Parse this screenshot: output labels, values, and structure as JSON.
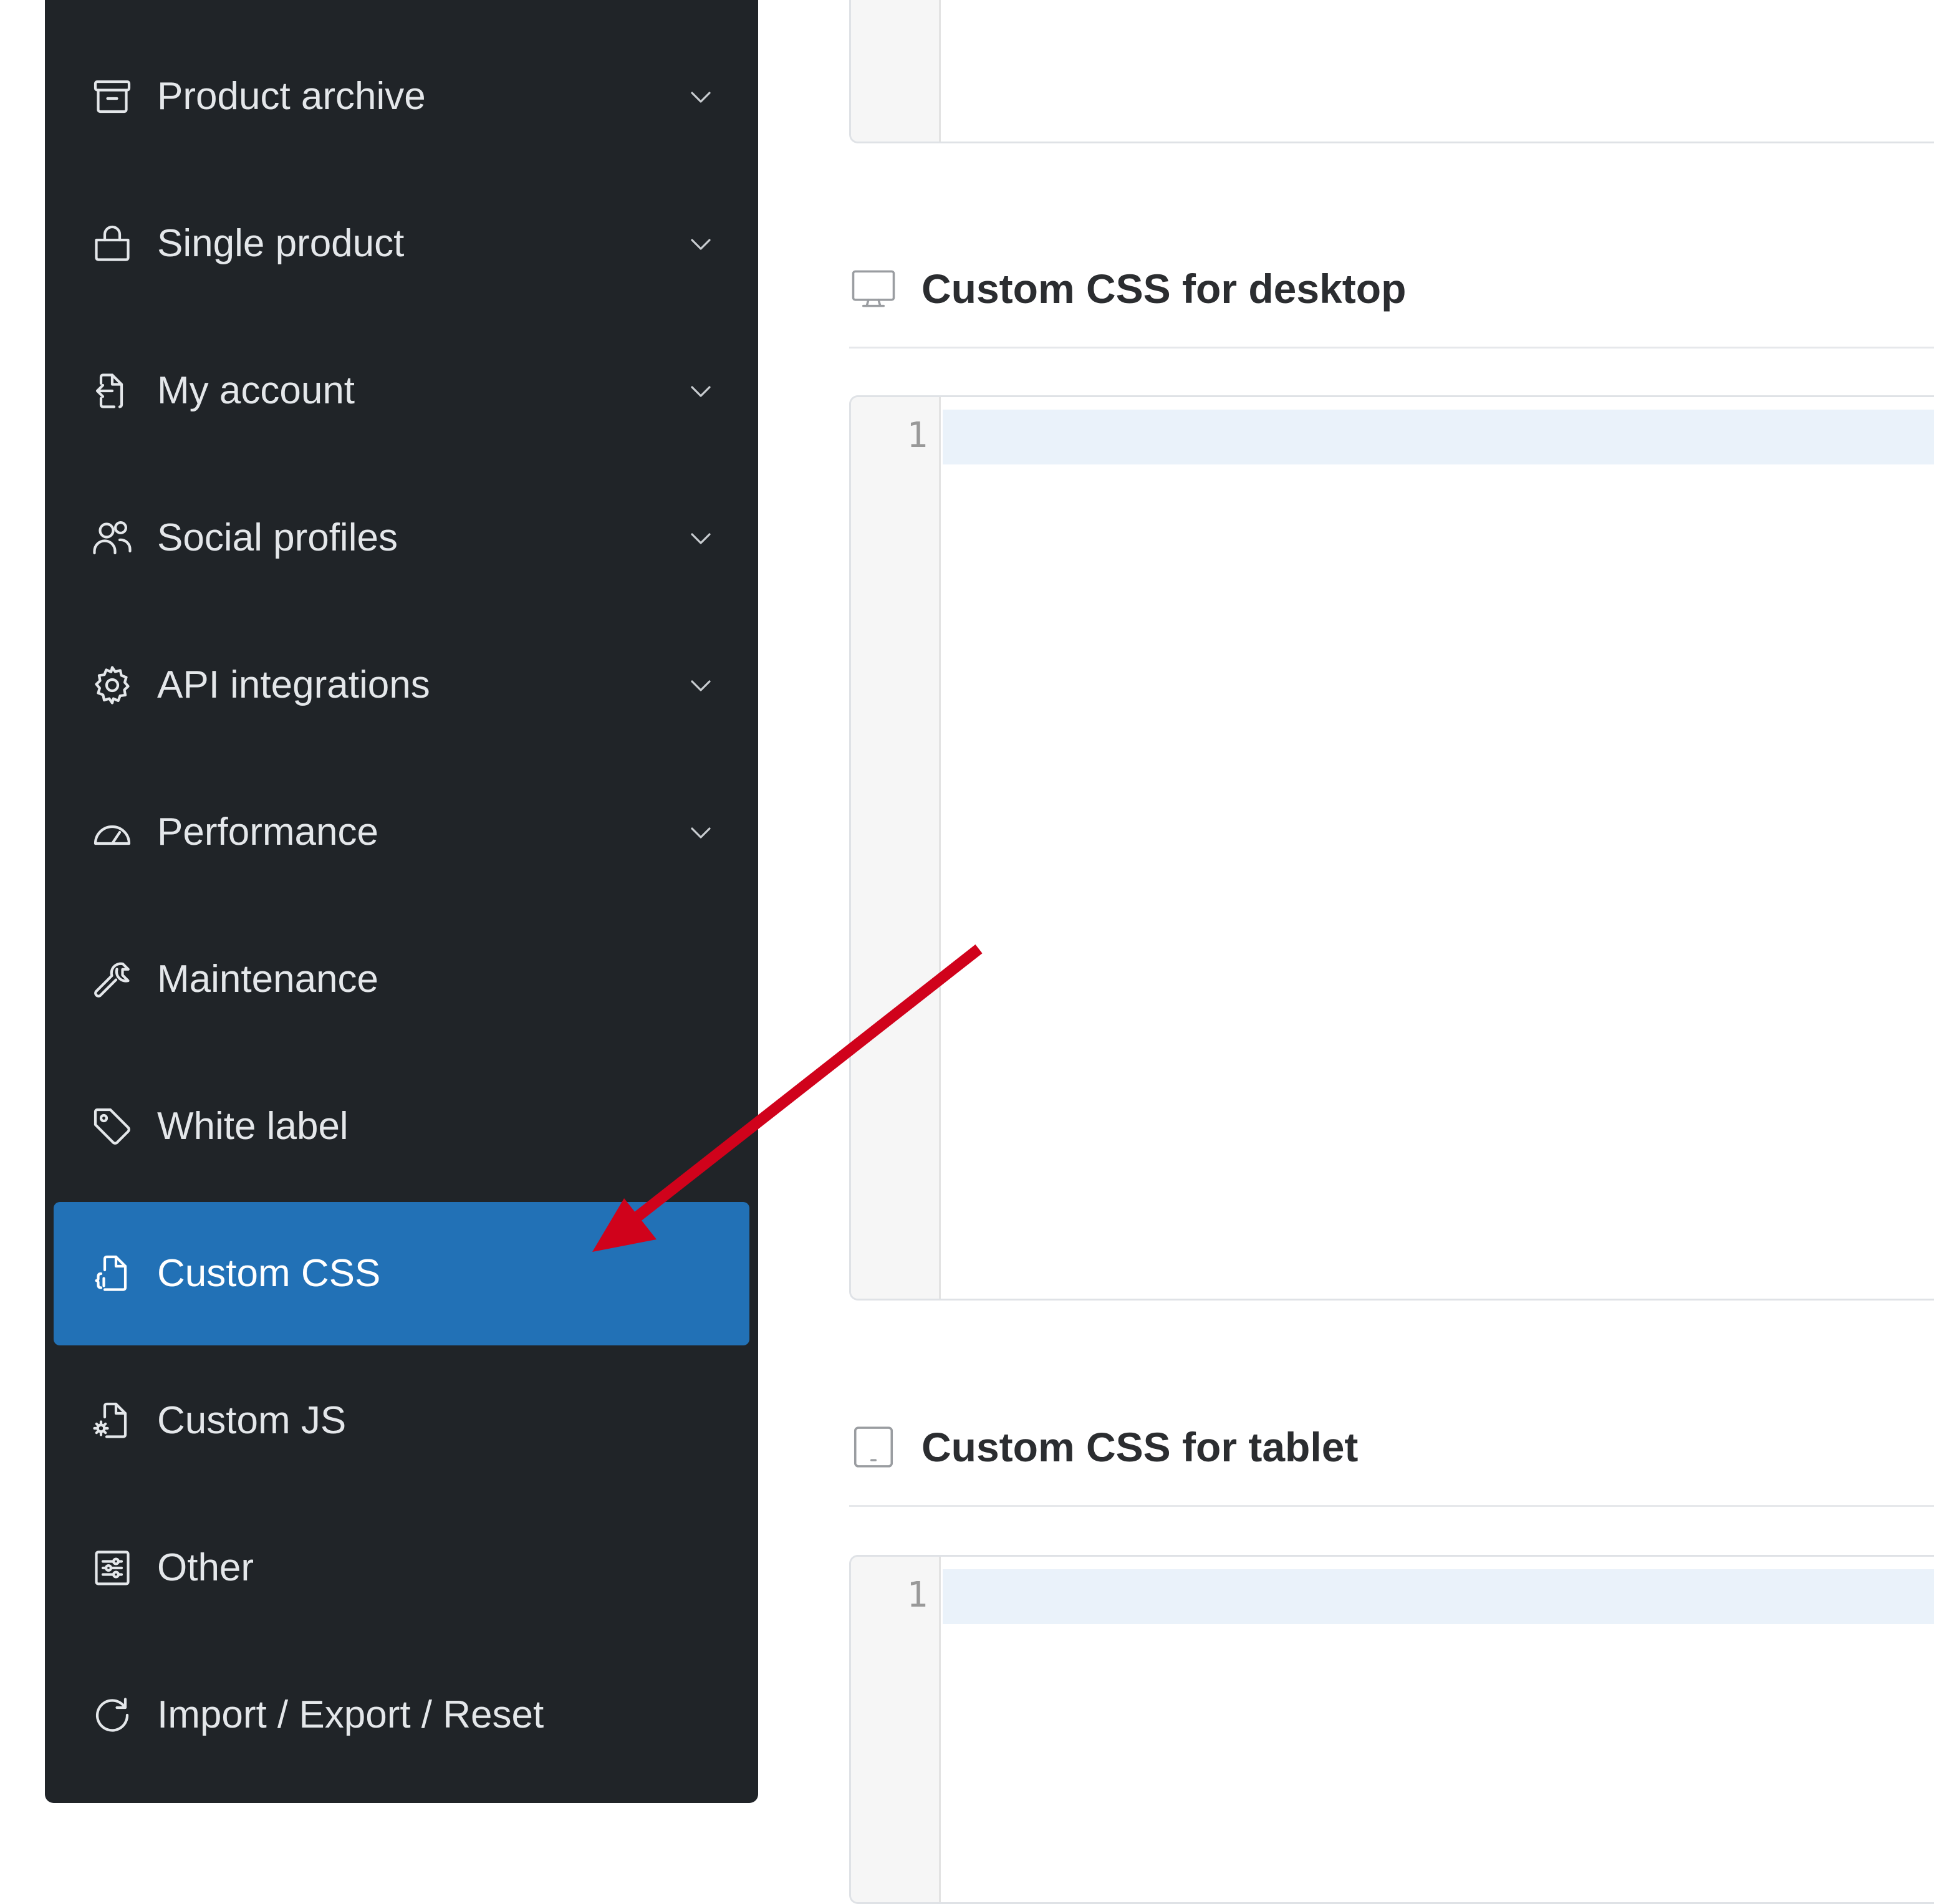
{
  "sidebar": {
    "items": [
      {
        "label": "Product archive",
        "icon": "archive-icon",
        "has_submenu": true
      },
      {
        "label": "Single product",
        "icon": "shopping-bag-icon",
        "has_submenu": true
      },
      {
        "label": "My account",
        "icon": "login-icon",
        "has_submenu": true
      },
      {
        "label": "Social profiles",
        "icon": "people-icon",
        "has_submenu": true
      },
      {
        "label": "API integrations",
        "icon": "gear-icon",
        "has_submenu": true
      },
      {
        "label": "Performance",
        "icon": "speedometer-icon",
        "has_submenu": true
      },
      {
        "label": "Maintenance",
        "icon": "wrench-icon",
        "has_submenu": false
      },
      {
        "label": "White label",
        "icon": "tag-icon",
        "has_submenu": false
      },
      {
        "label": "Custom CSS",
        "icon": "css-file-icon",
        "has_submenu": false,
        "active": true
      },
      {
        "label": "Custom JS",
        "icon": "js-file-icon",
        "has_submenu": false
      },
      {
        "label": "Other",
        "icon": "sliders-icon",
        "has_submenu": false
      },
      {
        "label": "Import / Export / Reset",
        "icon": "refresh-icon",
        "has_submenu": false
      }
    ],
    "active_item": "Custom CSS"
  },
  "main": {
    "desktop_section": {
      "title": "Custom CSS for desktop",
      "icon": "monitor-icon",
      "editor_line_number": "1"
    },
    "tablet_section": {
      "title": "Custom CSS for tablet",
      "icon": "tablet-icon",
      "editor_line_number": "1"
    }
  },
  "colors": {
    "sidebar_background": "#202428",
    "active_item_background": "#2271b6",
    "annotation_arrow": "#d0021b",
    "active_line_highlight": "#eaf2fa"
  }
}
